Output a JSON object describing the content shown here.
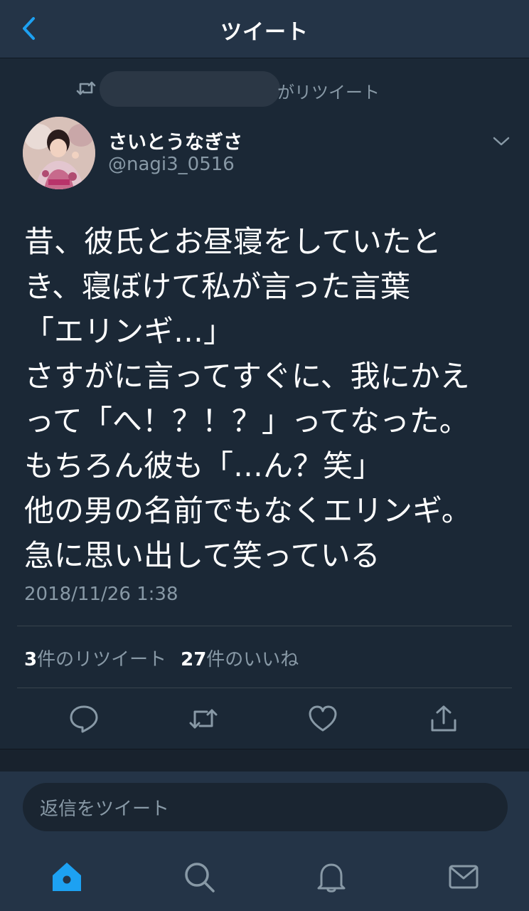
{
  "header": {
    "title": "ツイート",
    "back_icon": "chevron-left-icon"
  },
  "retweet_context": {
    "icon": "retweet-icon",
    "text": "がリツイート"
  },
  "tweet": {
    "author": {
      "display_name": "さいとうなぎさ",
      "handle": "@nagi3_0516"
    },
    "lines": [
      "昔、彼氏とお昼寝をしていたと",
      "き、寝ぼけて私が言った言葉",
      "「エリンギ…」",
      "さすがに言ってすぐに、我にかえ",
      "って「へ！？！？」ってなった。",
      "もちろん彼も「…ん？笑」",
      "他の男の名前でもなくエリンギ。",
      "急に思い出して笑っている"
    ],
    "timestamp": "2018/11/26 1:38",
    "stats": {
      "retweets": {
        "count": "3",
        "label": "件のリツイート"
      },
      "likes": {
        "count": "27",
        "label": "件のいいね"
      }
    }
  },
  "actions": [
    "reply-icon",
    "retweet-icon",
    "like-icon",
    "share-icon"
  ],
  "reply": {
    "placeholder": "返信をツイート"
  },
  "bottom_nav": [
    "home-icon",
    "search-icon",
    "notifications-icon",
    "messages-icon"
  ],
  "colors": {
    "accent": "#1da1f2",
    "background": "#1b2836",
    "bar": "#243447",
    "muted": "#8899a6"
  }
}
